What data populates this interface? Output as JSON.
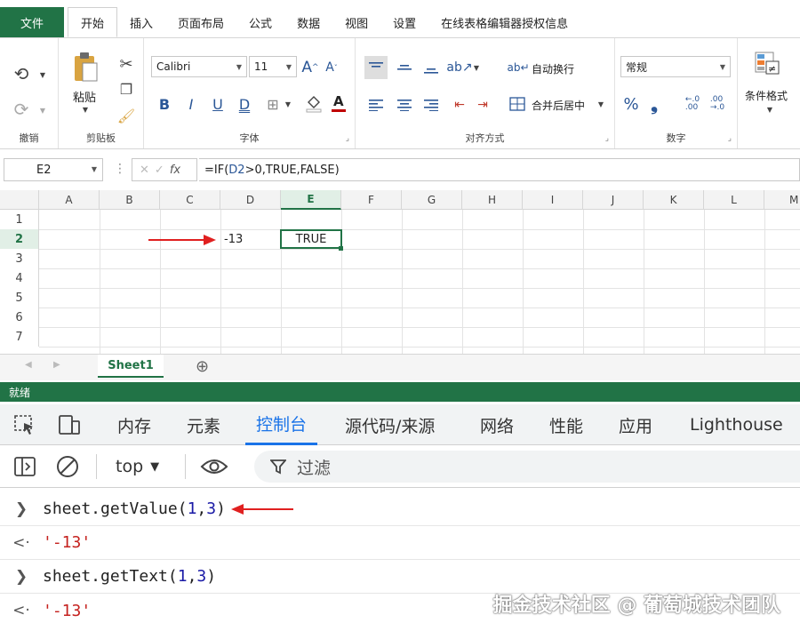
{
  "menu": {
    "file": "文件",
    "tabs": [
      "开始",
      "插入",
      "页面布局",
      "公式",
      "数据",
      "视图",
      "设置",
      "在线表格编辑器授权信息"
    ],
    "active_tab": "开始"
  },
  "ribbon": {
    "undo_group": "撤销",
    "clipboard_group": "剪贴板",
    "paste_label": "粘贴",
    "font_group": "字体",
    "font_name": "Calibri",
    "font_size": "11",
    "align_group": "对齐方式",
    "wrap_text": "自动换行",
    "merge_center": "合并后居中",
    "number_group": "数字",
    "number_format": "常规",
    "conditional_format": "条件格式"
  },
  "formula_bar": {
    "name_box": "E2",
    "formula_ref": "D2",
    "formula_prefix": "=IF(",
    "formula_suffix": ">0,TRUE,FALSE)"
  },
  "grid": {
    "columns": [
      "A",
      "B",
      "C",
      "D",
      "E",
      "F",
      "G",
      "H",
      "I",
      "J",
      "K",
      "L",
      "M"
    ],
    "rows": [
      "1",
      "2",
      "3",
      "4",
      "5",
      "6",
      "7"
    ],
    "selected_column": "E",
    "selected_row": "2",
    "cells": {
      "D2": "-13",
      "E2": "TRUE"
    }
  },
  "sheets": {
    "active": "Sheet1"
  },
  "status": {
    "text": "就绪"
  },
  "devtools": {
    "tabs": [
      "内存",
      "元素",
      "控制台",
      "源代码/来源",
      "网络",
      "性能",
      "应用",
      "Lighthouse"
    ],
    "active_tab": "控制台",
    "context": "top",
    "filter_placeholder": "过滤",
    "console": [
      {
        "type": "input",
        "obj": "sheet.",
        "method": "getValue",
        "args_open": "(",
        "arg1": "1",
        "sep": ",",
        "arg2": "3",
        "args_close": ")"
      },
      {
        "type": "output",
        "value": "'-13'"
      },
      {
        "type": "input",
        "obj": "sheet.",
        "method": "getText",
        "args_open": "(",
        "arg1": "1",
        "sep": ",",
        "arg2": "3",
        "args_close": ")"
      },
      {
        "type": "output",
        "value": "'-13'"
      }
    ]
  },
  "watermark": "掘金技术社区 @ 葡萄城技术团队",
  "colors": {
    "excel_green": "#217346",
    "devtools_blue": "#1a73e8",
    "annotation_red": "#e02020",
    "string_red": "#c5221f",
    "number_blue": "#1a1aa6"
  }
}
